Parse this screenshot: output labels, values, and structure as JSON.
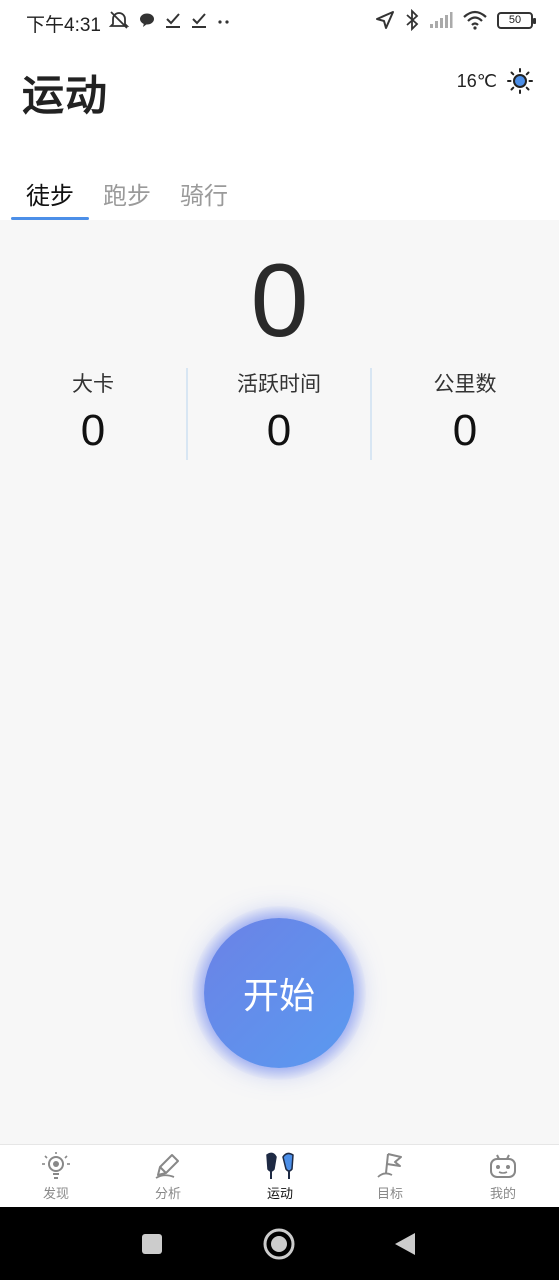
{
  "status_bar": {
    "time": "下午4:31",
    "battery": "50"
  },
  "header": {
    "title": "运动",
    "weather_temp": "16℃"
  },
  "tabs": [
    {
      "label": "徒步",
      "active": true
    },
    {
      "label": "跑步",
      "active": false
    },
    {
      "label": "骑行",
      "active": false
    }
  ],
  "main": {
    "steps": "0",
    "stats": [
      {
        "label": "大卡",
        "value": "0"
      },
      {
        "label": "活跃时间",
        "value": "0"
      },
      {
        "label": "公里数",
        "value": "0"
      }
    ],
    "start_label": "开始"
  },
  "bottom_nav": [
    {
      "label": "发现",
      "icon": "bulb-icon",
      "active": false
    },
    {
      "label": "分析",
      "icon": "pen-icon",
      "active": false
    },
    {
      "label": "运动",
      "icon": "sport-shoes-icon",
      "active": true
    },
    {
      "label": "目标",
      "icon": "flag-icon",
      "active": false
    },
    {
      "label": "我的",
      "icon": "robot-face-icon",
      "active": false
    }
  ],
  "colors": {
    "accent": "#4c8fe8",
    "start_gradient_start": "#6b82e6",
    "start_gradient_end": "#5a9af0"
  }
}
